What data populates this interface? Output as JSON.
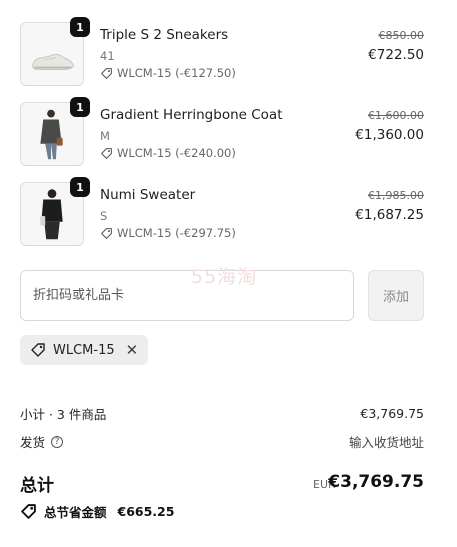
{
  "items": [
    {
      "qty": "1",
      "title": "Triple S 2 Sneakers",
      "variant": "41",
      "discount": "WLCM-15 (-€127.50)",
      "old_price": "€850.00",
      "price": "€722.50",
      "thumb_icon": "sneaker-photo"
    },
    {
      "qty": "1",
      "title": "Gradient Herringbone Coat",
      "variant": "M",
      "discount": "WLCM-15 (-€240.00)",
      "old_price": "€1,600.00",
      "price": "€1,360.00",
      "thumb_icon": "coat-model-photo"
    },
    {
      "qty": "1",
      "title": "Numi Sweater",
      "variant": "S",
      "discount": "WLCM-15 (-€297.75)",
      "old_price": "€1,985.00",
      "price": "€1,687.25",
      "thumb_icon": "sweater-model-photo"
    }
  ],
  "promo": {
    "placeholder": "折扣码或礼品卡",
    "add_label": "添加",
    "applied_code": "WLCM-15"
  },
  "watermark": "55海淘",
  "summary": {
    "subtotal_label": "小计 · 3 件商品",
    "subtotal_value": "€3,769.75",
    "shipping_label": "发货",
    "shipping_value": "输入收货地址",
    "total_label": "总计",
    "currency": "EUR",
    "total_value": "€3,769.75",
    "savings_label": "总节省金额",
    "savings_value": "€665.25"
  }
}
